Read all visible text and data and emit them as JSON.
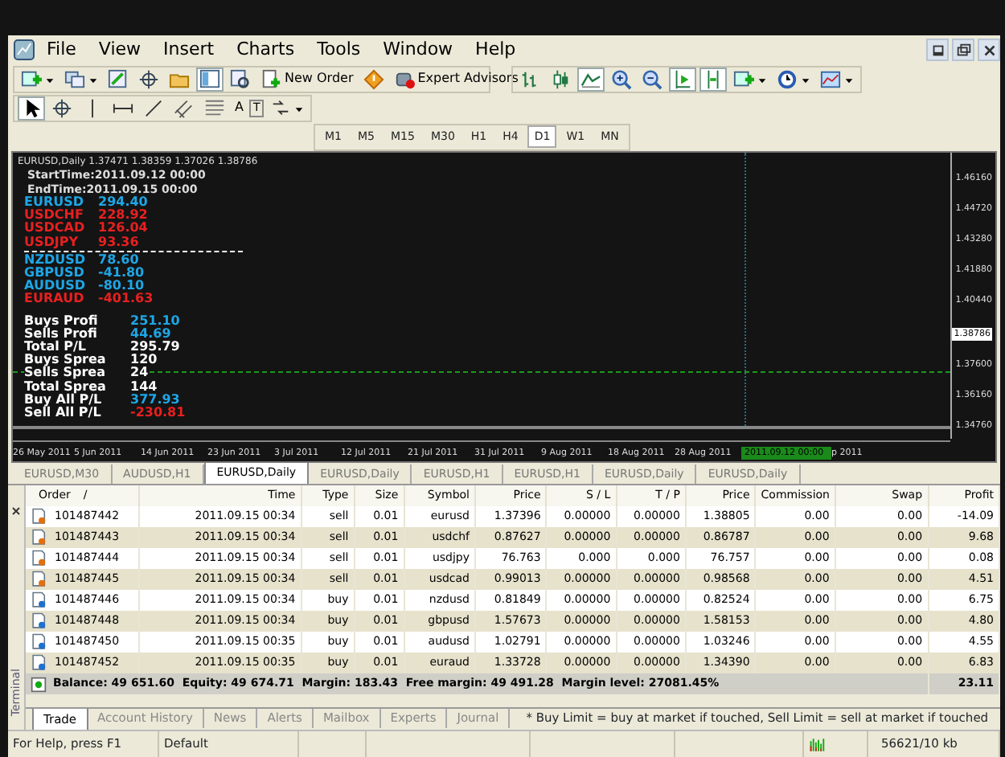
{
  "menu": [
    "File",
    "View",
    "Insert",
    "Charts",
    "Tools",
    "Window",
    "Help"
  ],
  "toolbar": {
    "new_order": "New Order",
    "expert_advisors": "Expert Advisors"
  },
  "drawing_tools": [
    "A",
    "T"
  ],
  "timeframes": [
    {
      "label": "M1",
      "selected": false
    },
    {
      "label": "M5",
      "selected": false
    },
    {
      "label": "M15",
      "selected": false
    },
    {
      "label": "M30",
      "selected": false
    },
    {
      "label": "H1",
      "selected": false
    },
    {
      "label": "H4",
      "selected": false
    },
    {
      "label": "D1",
      "selected": true
    },
    {
      "label": "W1",
      "selected": false
    },
    {
      "label": "MN",
      "selected": false
    }
  ],
  "chart": {
    "info": "EURUSD,Daily  1.37471 1.38359 1.37026 1.38786",
    "start_time": "StartTime:2011.09.12 00:00",
    "end_time": "EndTime:2011.09.15 00:00",
    "pairs": [
      {
        "symbol": "EURUSD",
        "value": "294.40",
        "color": "#1ea6e6"
      },
      {
        "symbol": "USDCHF",
        "value": "228.92",
        "color": "#e82020"
      },
      {
        "symbol": "USDCAD",
        "value": "126.04",
        "color": "#e82020"
      },
      {
        "symbol": "USDJPY",
        "value": "93.36",
        "color": "#e82020"
      },
      {
        "symbol": "NZDUSD",
        "value": "78.60",
        "color": "#1ea6e6"
      },
      {
        "symbol": "GBPUSD",
        "value": "-41.80",
        "color": "#1ea6e6"
      },
      {
        "symbol": "AUDUSD",
        "value": "-80.10",
        "color": "#1ea6e6"
      },
      {
        "symbol": "EURAUD",
        "value": "-401.63",
        "color": "#e82020"
      }
    ],
    "stats": [
      {
        "label": "Buys Profi",
        "value": "251.10",
        "color": "#1ea6e6"
      },
      {
        "label": "Sells Profi",
        "value": "44.69",
        "color": "#1ea6e6"
      },
      {
        "label": "Total P/L",
        "value": "295.79",
        "color": "#ffffff"
      },
      {
        "label": "Buys Sprea",
        "value": "120",
        "color": "#ffffff"
      },
      {
        "label": "Sells Sprea",
        "value": "24",
        "color": "#ffffff"
      },
      {
        "label": "Total Sprea",
        "value": "144",
        "color": "#ffffff"
      },
      {
        "label": "Buy All P/L",
        "value": "377.93",
        "color": "#1ea6e6"
      },
      {
        "label": "Sell All P/L",
        "value": "-230.81",
        "color": "#e82020"
      }
    ],
    "price_axis": [
      {
        "label": "1.46160",
        "kind": "tick"
      },
      {
        "label": "1.44720",
        "kind": "tick"
      },
      {
        "label": "1.43280",
        "kind": "tick"
      },
      {
        "label": "1.41880",
        "kind": "tick"
      },
      {
        "label": "1.40440",
        "kind": "tick"
      },
      {
        "label": "1.38786",
        "kind": "current"
      },
      {
        "label": "1.37600",
        "kind": "tick"
      },
      {
        "label": "1.36160",
        "kind": "tick"
      },
      {
        "label": "1.34760",
        "kind": "tick"
      }
    ],
    "date_axis": [
      {
        "label": "26 May 2011",
        "kind": "tick"
      },
      {
        "label": "5 Jun 2011",
        "kind": "tick"
      },
      {
        "label": "14 Jun 2011",
        "kind": "tick"
      },
      {
        "label": "23 Jun 2011",
        "kind": "tick"
      },
      {
        "label": "3 Jul 2011",
        "kind": "tick"
      },
      {
        "label": "12 Jul 2011",
        "kind": "tick"
      },
      {
        "label": "21 Jul 2011",
        "kind": "tick"
      },
      {
        "label": "31 Jul 2011",
        "kind": "tick"
      },
      {
        "label": "9 Aug 2011",
        "kind": "tick"
      },
      {
        "label": "18 Aug 2011",
        "kind": "tick"
      },
      {
        "label": "28 Aug 2011",
        "kind": "tick"
      },
      {
        "label": "2011.09.12 00:00",
        "kind": "cursor"
      },
      {
        "label": "p 2011",
        "kind": "tick"
      }
    ]
  },
  "chart_tabs": [
    {
      "label": "EURUSD,M30",
      "selected": false
    },
    {
      "label": "AUDUSD,H1",
      "selected": false
    },
    {
      "label": "EURUSD,Daily",
      "selected": true
    },
    {
      "label": "EURUSD,Daily",
      "selected": false
    },
    {
      "label": "EURUSD,H1",
      "selected": false
    },
    {
      "label": "EURUSD,H1",
      "selected": false
    },
    {
      "label": "EURUSD,Daily",
      "selected": false
    },
    {
      "label": "EURUSD,Daily",
      "selected": false
    }
  ],
  "table": {
    "columns": [
      "Order",
      "Time",
      "Type",
      "Size",
      "Symbol",
      "Price",
      "S / L",
      "T / P",
      "Price",
      "Commission",
      "Swap",
      "Profit"
    ],
    "sort_mark": "/",
    "rows": [
      {
        "kind": "sell",
        "cells": [
          "101487442",
          "2011.09.15 00:34",
          "sell",
          "0.01",
          "eurusd",
          "1.37396",
          "0.00000",
          "0.00000",
          "1.38805",
          "0.00",
          "0.00",
          "-14.09"
        ]
      },
      {
        "kind": "sell",
        "cells": [
          "101487443",
          "2011.09.15 00:34",
          "sell",
          "0.01",
          "usdchf",
          "0.87627",
          "0.00000",
          "0.00000",
          "0.86787",
          "0.00",
          "0.00",
          "9.68"
        ]
      },
      {
        "kind": "sell",
        "cells": [
          "101487444",
          "2011.09.15 00:34",
          "sell",
          "0.01",
          "usdjpy",
          "76.763",
          "0.000",
          "0.000",
          "76.757",
          "0.00",
          "0.00",
          "0.08"
        ]
      },
      {
        "kind": "sell",
        "cells": [
          "101487445",
          "2011.09.15 00:34",
          "sell",
          "0.01",
          "usdcad",
          "0.99013",
          "0.00000",
          "0.00000",
          "0.98568",
          "0.00",
          "0.00",
          "4.51"
        ]
      },
      {
        "kind": "buy",
        "cells": [
          "101487446",
          "2011.09.15 00:34",
          "buy",
          "0.01",
          "nzdusd",
          "0.81849",
          "0.00000",
          "0.00000",
          "0.82524",
          "0.00",
          "0.00",
          "6.75"
        ]
      },
      {
        "kind": "buy",
        "cells": [
          "101487448",
          "2011.09.15 00:34",
          "buy",
          "0.01",
          "gbpusd",
          "1.57673",
          "0.00000",
          "0.00000",
          "1.58153",
          "0.00",
          "0.00",
          "4.80"
        ]
      },
      {
        "kind": "buy",
        "cells": [
          "101487450",
          "2011.09.15 00:35",
          "buy",
          "0.01",
          "audusd",
          "1.02791",
          "0.00000",
          "0.00000",
          "1.03246",
          "0.00",
          "0.00",
          "4.55"
        ]
      },
      {
        "kind": "buy",
        "cells": [
          "101487452",
          "2011.09.15 00:35",
          "buy",
          "0.01",
          "euraud",
          "1.33728",
          "0.00000",
          "0.00000",
          "1.34390",
          "0.00",
          "0.00",
          "6.83"
        ]
      }
    ],
    "summary": "Balance: 49 651.60  Equity: 49 674.71  Margin: 183.43  Free margin: 49 491.28  Margin level: 27081.45%",
    "total": "23.11"
  },
  "terminal": {
    "title": "Terminal",
    "tabs": [
      {
        "label": "Trade",
        "selected": true
      },
      {
        "label": "Account History",
        "selected": false
      },
      {
        "label": "News",
        "selected": false
      },
      {
        "label": "Alerts",
        "selected": false
      },
      {
        "label": "Mailbox",
        "selected": false
      },
      {
        "label": "Experts",
        "selected": false
      },
      {
        "label": "Journal",
        "selected": false
      }
    ],
    "message": "* Buy Limit = buy at market if touched, Sell Limit = sell at market if touched"
  },
  "status_bar": {
    "help": "For Help, press F1",
    "profile": "Default",
    "traffic": "56621/10 kb"
  }
}
